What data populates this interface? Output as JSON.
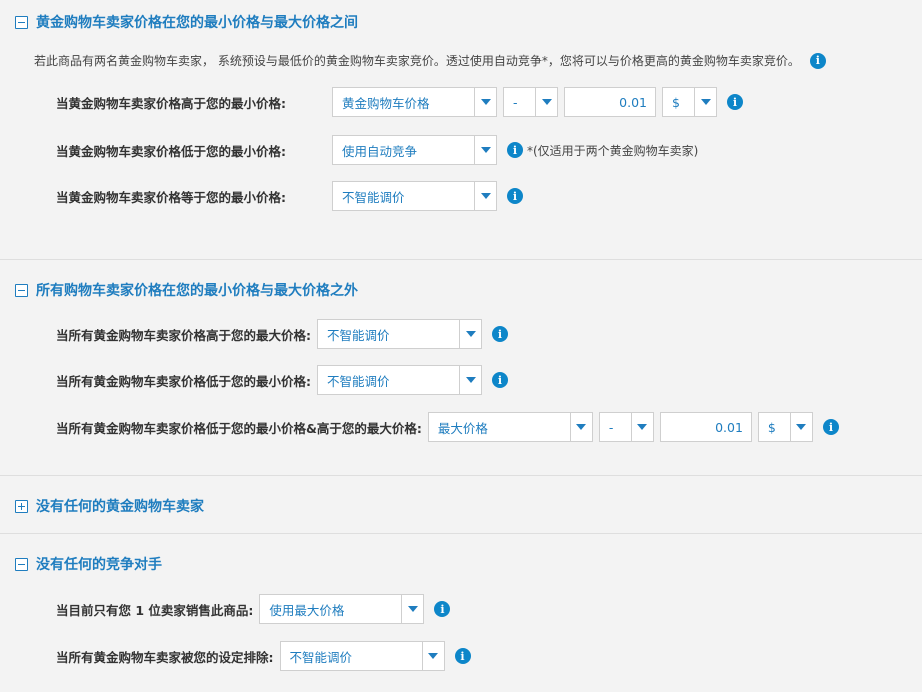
{
  "sections": [
    {
      "title": "黄金购物车卖家价格在您的最小价格与最大价格之间",
      "expanded": true,
      "description": "若此商品有两名黄金购物车卖家， 系统预设与最低价的黄金购物车卖家竞价。透过使用自动竞争*，您将可以与价格更高的黄金购物车卖家竞价。",
      "rows": [
        {
          "label": "当黄金购物车卖家价格高于您的最小价格:",
          "select": "黄金购物车价格",
          "operator": "-",
          "amount": "0.01",
          "unit": "$"
        },
        {
          "label": "当黄金购物车卖家价格低于您的最小价格:",
          "select": "使用自动竞争",
          "note": "*(仅适用于两个黄金购物车卖家)"
        },
        {
          "label": "当黄金购物车卖家价格等于您的最小价格:",
          "select": "不智能调价"
        }
      ]
    },
    {
      "title": "所有购物车卖家价格在您的最小价格与最大价格之外",
      "expanded": true,
      "rows": [
        {
          "label": "当所有黄金购物车卖家价格高于您的最大价格:",
          "select": "不智能调价"
        },
        {
          "label": "当所有黄金购物车卖家价格低于您的最小价格:",
          "select": "不智能调价"
        },
        {
          "label": "当所有黄金购物车卖家价格低于您的最小价格&高于您的最大价格:",
          "select": "最大价格",
          "operator": "-",
          "amount": "0.01",
          "unit": "$"
        }
      ]
    },
    {
      "title": "没有任何的黄金购物车卖家",
      "expanded": false
    },
    {
      "title": "没有任何的竞争对手",
      "expanded": true,
      "rows": [
        {
          "label": "当目前只有您 1 位卖家销售此商品:",
          "select": "使用最大价格"
        },
        {
          "label": "当所有黄金购物车卖家被您的设定排除:",
          "select": "不智能调价"
        }
      ]
    }
  ],
  "icons": {
    "info": "info-icon",
    "collapse": "minus-square-icon",
    "expand": "plus-square-icon"
  },
  "colors": {
    "accent": "#1f7dbf",
    "info": "#0d86c9",
    "background": "#f3f3f3"
  }
}
